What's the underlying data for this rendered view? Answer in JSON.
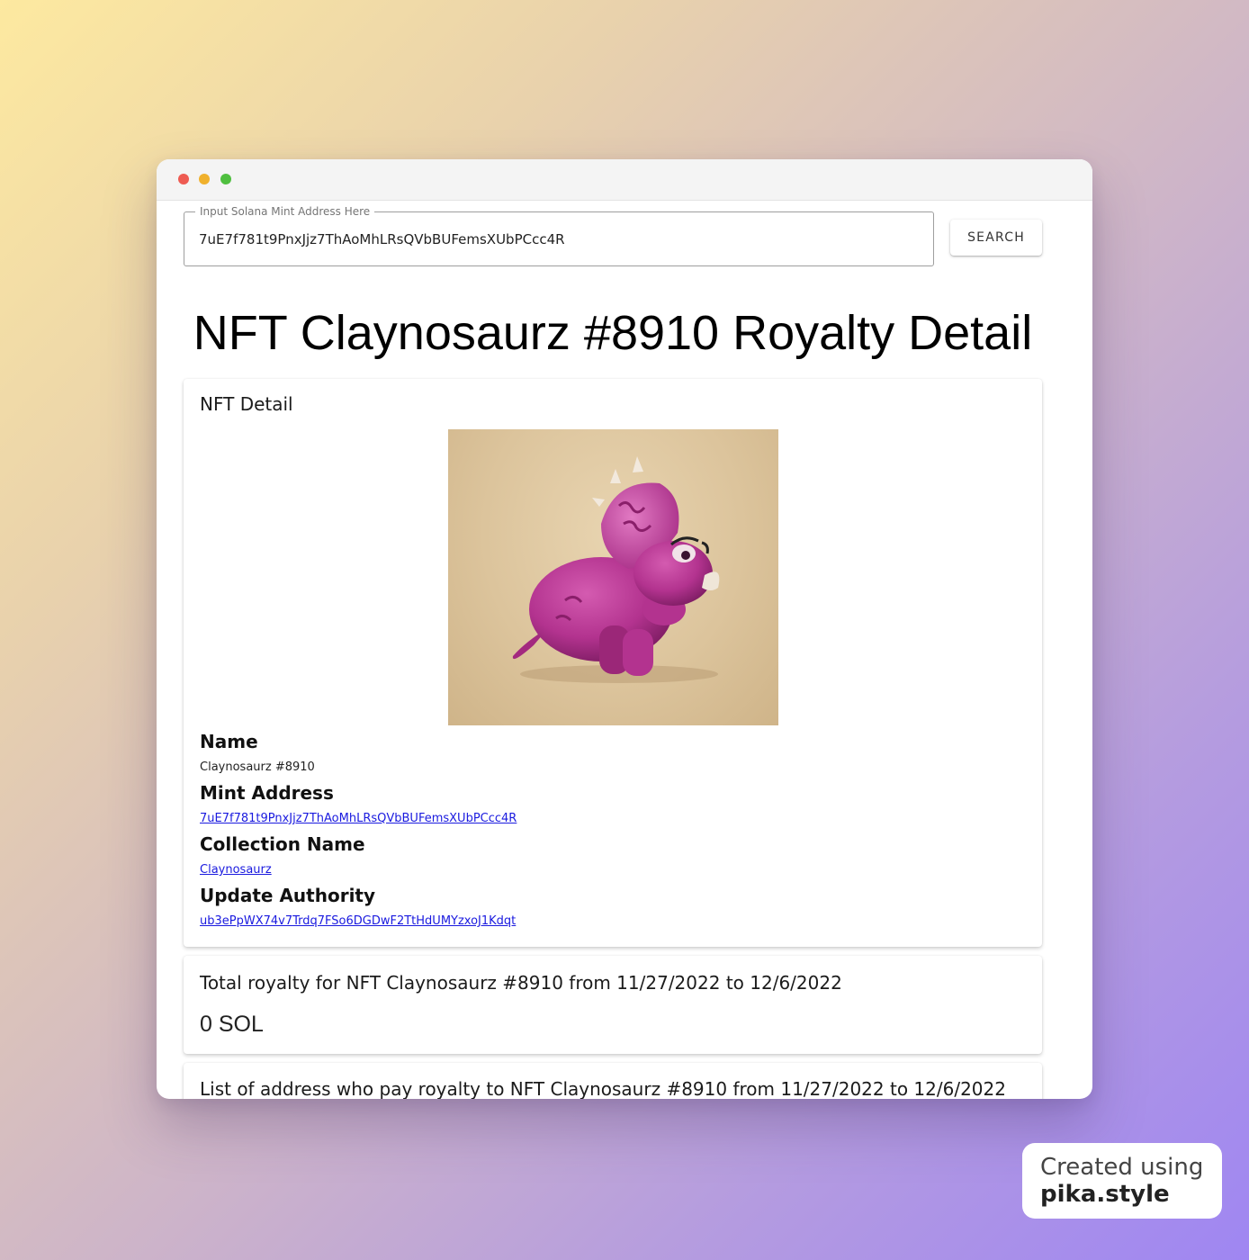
{
  "search": {
    "label": "Input Solana Mint Address Here",
    "value": "7uE7f781t9PnxJjz7ThAoMhLRsQVbBUFemsXUbPCcc4R",
    "button_label": "SEARCH"
  },
  "page": {
    "title": "NFT Claynosaurz #8910 Royalty Detail"
  },
  "nft_detail": {
    "heading": "NFT Detail",
    "image_alt": "pink clay triceratops",
    "name_label": "Name",
    "name_value": "Claynosaurz #8910",
    "mint_label": "Mint Address",
    "mint_value": "7uE7f781t9PnxJjz7ThAoMhLRsQVbBUFemsXUbPCcc4R",
    "collection_label": "Collection Name",
    "collection_value": "Claynosaurz",
    "authority_label": "Update Authority",
    "authority_value": "ub3ePpWX74v7Trdq7FSo6DGDwF2TtHdUMYzxoJ1Kdqt"
  },
  "total_royalty": {
    "heading": "Total royalty for NFT Claynosaurz #8910 from 11/27/2022 to 12/6/2022",
    "value": "0 SOL"
  },
  "payer_list": {
    "heading": "List of address who pay royalty to NFT Claynosaurz #8910 from 11/27/2022 to 12/6/2022"
  },
  "badge": {
    "line1": "Created using",
    "line2": "pika.style"
  },
  "colors": {
    "link": "#1a1adf",
    "dino": "#b3338f"
  }
}
